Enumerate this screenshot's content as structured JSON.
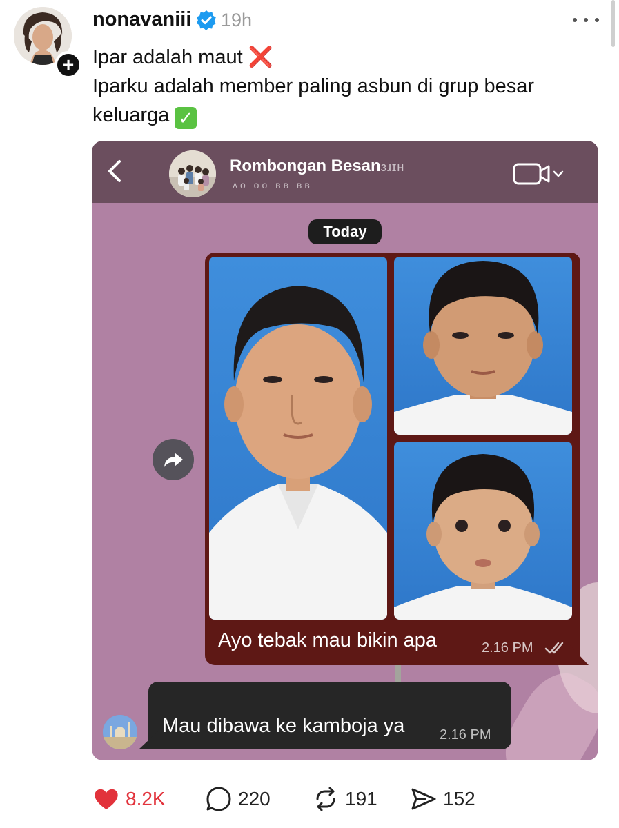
{
  "post": {
    "username": "nonavaniii",
    "time": "19h",
    "lines": [
      "Ipar adalah maut",
      "Iparku adalah member paling asbun di grup besar",
      "keluarga"
    ]
  },
  "chat": {
    "group_name": "Rombongan Besan",
    "group_name_blur": "ɜɹɪʜ",
    "group_sub": "ᴧo oo ʙʙ ʙʙ",
    "date_chip": "Today",
    "sent_caption": "Ayo tebak mau bikin apa",
    "sent_time": "2.16 PM",
    "reply_text": "Mau dibawa ke kamboja ya",
    "reply_time": "2.16 PM"
  },
  "actions": {
    "likes": "8.2K",
    "replies": "220",
    "reposts": "191",
    "shares": "152"
  },
  "icons": {
    "verified": "verified-badge-icon",
    "follow": "plus-icon",
    "more": "more-dots-icon",
    "back": "chevron-left-icon",
    "video": "video-camera-icon",
    "forward": "forward-arrow-icon",
    "like": "heart-icon",
    "reply": "comment-bubble-icon",
    "repost": "repost-icon",
    "share": "send-icon"
  },
  "colors": {
    "like": "#e2323b",
    "verified": "#1d9bf0",
    "chat_bg": "#b081a3",
    "chat_header": "#6b4e5e",
    "sent_bubble": "#5e1815",
    "received_bubble": "#262626"
  }
}
